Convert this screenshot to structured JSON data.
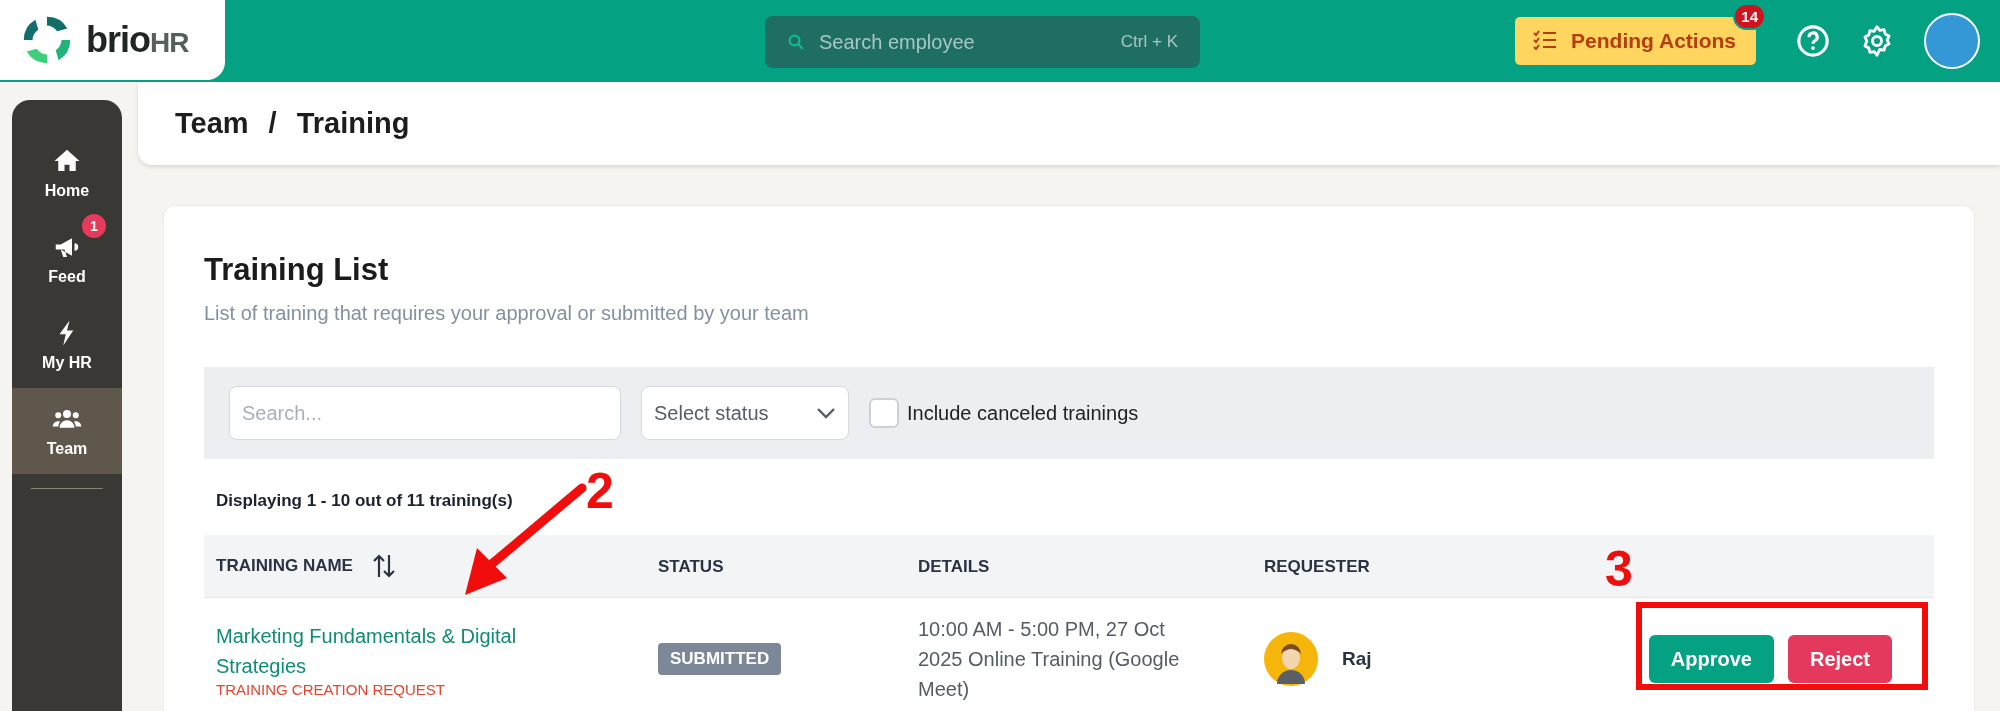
{
  "header": {
    "logo": {
      "brand": "brio",
      "suffix": "HR"
    },
    "search": {
      "placeholder": "Search employee",
      "shortcut": "Ctrl + K"
    },
    "pending_actions": {
      "label": "Pending Actions",
      "badge": "14"
    }
  },
  "sidebar": {
    "items": [
      {
        "label": "Home",
        "kind": "home",
        "selected": false
      },
      {
        "label": "Feed",
        "kind": "megaphone",
        "selected": false,
        "badge": "1"
      },
      {
        "label": "My HR",
        "kind": "bolt",
        "selected": false
      },
      {
        "label": "Team",
        "kind": "people",
        "selected": true
      }
    ]
  },
  "breadcrumb": [
    "Team",
    "/",
    "Training"
  ],
  "training_list": {
    "title": "Training List",
    "subtitle": "List of training that requires your approval or submitted by your team",
    "filters": {
      "search_placeholder": "Search...",
      "status_placeholder": "Select status",
      "include_canceled": {
        "label": "Include canceled trainings",
        "checked": false
      }
    },
    "count_text": "Displaying 1 - 10 out of 11 training(s)",
    "table": {
      "columns": [
        "TRAINING NAME",
        "STATUS",
        "DETAILS",
        "REQUESTER"
      ],
      "rows": [
        {
          "name": "Marketing Fundamentals & Digital Strategies",
          "request_type": "TRAINING CREATION REQUEST",
          "status": "SUBMITTED",
          "details": "10:00 AM - 5:00 PM, 27 Oct 2025 Online Training (Google Meet)",
          "requester": "Raj",
          "actions": [
            "Approve",
            "Reject"
          ]
        }
      ]
    }
  },
  "annotations": [
    {
      "label": "2",
      "kind": "arrow"
    },
    {
      "label": "3",
      "kind": "frame"
    }
  ]
}
